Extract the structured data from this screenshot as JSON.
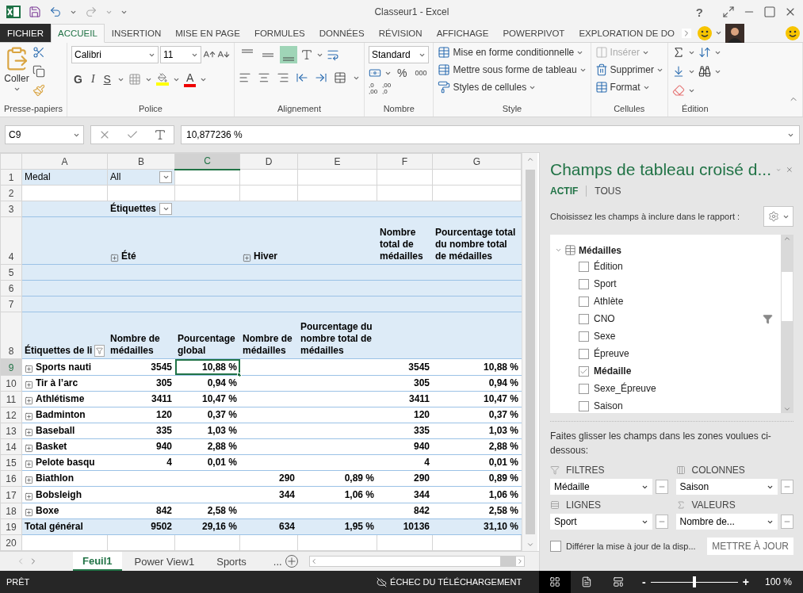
{
  "title_bar": {
    "title": "Classeur1 - Excel",
    "help": "?"
  },
  "ribbon_tabs": [
    {
      "label": "FICHIER",
      "kind": "file",
      "selected": false
    },
    {
      "label": "ACCUEIL",
      "kind": "tab",
      "selected": true
    },
    {
      "label": "INSERTION",
      "kind": "tab",
      "selected": false
    },
    {
      "label": "MISE EN PAGE",
      "kind": "tab",
      "selected": false
    },
    {
      "label": "FORMULES",
      "kind": "tab",
      "selected": false
    },
    {
      "label": "DONNÉES",
      "kind": "tab",
      "selected": false
    },
    {
      "label": "RÉVISION",
      "kind": "tab",
      "selected": false
    },
    {
      "label": "AFFICHAGE",
      "kind": "tab",
      "selected": false
    },
    {
      "label": "POWERPIVOT",
      "kind": "tab",
      "selected": false
    },
    {
      "label": "EXPLORATION DE DO",
      "kind": "tab",
      "selected": false
    }
  ],
  "ribbon": {
    "clipboard": {
      "paste": "Coller",
      "label": "Presse-papiers"
    },
    "font": {
      "name": "Calibri",
      "size": "11",
      "bold": "G",
      "italic": "I",
      "underline": "S",
      "font_color": "A",
      "label": "Police"
    },
    "alignment": {
      "vertical": [
        {
          "selected": false
        },
        {
          "selected": false
        },
        {
          "selected": true
        }
      ],
      "label": "Alignement"
    },
    "number": {
      "format": "Standard",
      "percent": "%",
      "thousands": "000",
      "decimals": [
        [
          ",0",
          ",00"
        ],
        [
          ",00",
          ",0"
        ]
      ],
      "label": "Nombre"
    },
    "styles": {
      "buttons": [
        "Mise en forme conditionnelle",
        "Mettre sous forme de tableau",
        "Styles de cellules"
      ],
      "label": "Style"
    },
    "cells": {
      "buttons": [
        {
          "label": "Insérer",
          "disabled": true
        },
        {
          "label": "Supprimer",
          "disabled": false
        },
        {
          "label": "Format",
          "disabled": false
        }
      ],
      "label": "Cellules"
    },
    "editing": {
      "label": "Édition"
    }
  },
  "formula_bar": {
    "name_box": "C9",
    "formula": "10,877236 %"
  },
  "sheet": {
    "columns": [
      "A",
      "B",
      "C",
      "D",
      "E",
      "F",
      "G"
    ],
    "rows": [
      {
        "num": "1",
        "kind": "page_filter",
        "tall": false,
        "cells": [
          {
            "text": "Medal",
            "selected": false
          },
          {
            "text": "All",
            "dropdown": true,
            "selected": false
          },
          {
            "selected": false
          },
          {
            "selected": false
          },
          {
            "selected": false
          },
          {
            "selected": false
          },
          {
            "selected": false
          }
        ]
      },
      {
        "num": "2",
        "kind": "blank",
        "tall": false,
        "cells": [
          {
            "selected": false
          },
          {
            "selected": false
          },
          {
            "selected": false
          },
          {
            "selected": false
          },
          {
            "selected": false
          },
          {
            "selected": false
          },
          {
            "selected": false
          }
        ]
      },
      {
        "num": "3",
        "kind": "header",
        "tall": false,
        "cells": [
          {
            "selected": false
          },
          {
            "text": "Étiquettes",
            "dropdown": true,
            "selected": false
          },
          {
            "selected": false
          },
          {
            "selected": false
          },
          {
            "selected": false
          },
          {
            "selected": false
          },
          {
            "selected": false
          }
        ]
      },
      {
        "num": "4",
        "kind": "header",
        "tall": true,
        "cells": [
          {
            "selected": false
          },
          {
            "text": "Été",
            "expand": true,
            "selected": false
          },
          {
            "selected": false
          },
          {
            "text": "Hiver",
            "expand": true,
            "selected": false
          },
          {
            "selected": false
          },
          {
            "text": "Nombre total de médailles",
            "selected": false
          },
          {
            "text": "Pourcentage total du nombre total de médailles",
            "selected": false
          }
        ]
      },
      {
        "num": "5",
        "kind": "header",
        "tall": false,
        "cells": [
          {
            "selected": false
          },
          {
            "selected": false
          },
          {
            "selected": false
          },
          {
            "selected": false
          },
          {
            "selected": false
          },
          {
            "selected": false
          },
          {
            "selected": false
          }
        ]
      },
      {
        "num": "6",
        "kind": "header",
        "tall": false,
        "cells": [
          {
            "selected": false
          },
          {
            "selected": false
          },
          {
            "selected": false
          },
          {
            "selected": false
          },
          {
            "selected": false
          },
          {
            "selected": false
          },
          {
            "selected": false
          }
        ]
      },
      {
        "num": "7",
        "kind": "header",
        "tall": false,
        "cells": [
          {
            "selected": false
          },
          {
            "selected": false
          },
          {
            "selected": false
          },
          {
            "selected": false
          },
          {
            "selected": false
          },
          {
            "selected": false
          },
          {
            "selected": false
          }
        ]
      },
      {
        "num": "8",
        "kind": "header",
        "tall": true,
        "cells": [
          {
            "text": "Étiquettes de li",
            "filter": true,
            "selected": false
          },
          {
            "text": "Nombre de médailles",
            "selected": false
          },
          {
            "text": "Pourcentage global",
            "selected": false
          },
          {
            "text": "Nombre de médailles",
            "selected": false
          },
          {
            "text": "Pourcentage du nombre total de médailles",
            "selected": false
          },
          {
            "selected": false
          },
          {
            "selected": false
          }
        ]
      },
      {
        "num": "9",
        "kind": "data",
        "tall": false,
        "cells": [
          {
            "text": "Sports nauti",
            "expand": true,
            "selected": false
          },
          {
            "text": "3545",
            "selected": false
          },
          {
            "text": "10,88 %",
            "selected": true
          },
          {
            "selected": false
          },
          {
            "selected": false
          },
          {
            "text": "3545",
            "selected": false
          },
          {
            "text": "10,88 %",
            "selected": false
          }
        ]
      },
      {
        "num": "10",
        "kind": "data",
        "tall": false,
        "cells": [
          {
            "text": "Tir à l’arc",
            "expand": true,
            "selected": false
          },
          {
            "text": "305",
            "selected": false
          },
          {
            "text": "0,94 %",
            "selected": false
          },
          {
            "selected": false
          },
          {
            "selected": false
          },
          {
            "text": "305",
            "selected": false
          },
          {
            "text": "0,94 %",
            "selected": false
          }
        ]
      },
      {
        "num": "11",
        "kind": "data",
        "tall": false,
        "cells": [
          {
            "text": "Athlétisme",
            "expand": true,
            "selected": false
          },
          {
            "text": "3411",
            "selected": false
          },
          {
            "text": "10,47 %",
            "selected": false
          },
          {
            "selected": false
          },
          {
            "selected": false
          },
          {
            "text": "3411",
            "selected": false
          },
          {
            "text": "10,47 %",
            "selected": false
          }
        ]
      },
      {
        "num": "12",
        "kind": "data",
        "tall": false,
        "cells": [
          {
            "text": "Badminton",
            "expand": true,
            "selected": false
          },
          {
            "text": "120",
            "selected": false
          },
          {
            "text": "0,37 %",
            "selected": false
          },
          {
            "selected": false
          },
          {
            "selected": false
          },
          {
            "text": "120",
            "selected": false
          },
          {
            "text": "0,37 %",
            "selected": false
          }
        ]
      },
      {
        "num": "13",
        "kind": "data",
        "tall": false,
        "cells": [
          {
            "text": "Baseball",
            "expand": true,
            "selected": false
          },
          {
            "text": "335",
            "selected": false
          },
          {
            "text": "1,03 %",
            "selected": false
          },
          {
            "selected": false
          },
          {
            "selected": false
          },
          {
            "text": "335",
            "selected": false
          },
          {
            "text": "1,03 %",
            "selected": false
          }
        ]
      },
      {
        "num": "14",
        "kind": "data",
        "tall": false,
        "cells": [
          {
            "text": "Basket",
            "expand": true,
            "selected": false
          },
          {
            "text": "940",
            "selected": false
          },
          {
            "text": "2,88 %",
            "selected": false
          },
          {
            "selected": false
          },
          {
            "selected": false
          },
          {
            "text": "940",
            "selected": false
          },
          {
            "text": "2,88 %",
            "selected": false
          }
        ]
      },
      {
        "num": "15",
        "kind": "data",
        "tall": false,
        "cells": [
          {
            "text": "Pelote basqu",
            "expand": true,
            "selected": false
          },
          {
            "text": "4",
            "selected": false
          },
          {
            "text": "0,01 %",
            "selected": false
          },
          {
            "selected": false
          },
          {
            "selected": false
          },
          {
            "text": "4",
            "selected": false
          },
          {
            "text": "0,01 %",
            "selected": false
          }
        ]
      },
      {
        "num": "16",
        "kind": "data",
        "tall": false,
        "cells": [
          {
            "text": "Biathlon",
            "expand": true,
            "selected": false
          },
          {
            "selected": false
          },
          {
            "selected": false
          },
          {
            "text": "290",
            "selected": false
          },
          {
            "text": "0,89 %",
            "selected": false
          },
          {
            "text": "290",
            "selected": false
          },
          {
            "text": "0,89 %",
            "selected": false
          }
        ]
      },
      {
        "num": "17",
        "kind": "data",
        "tall": false,
        "cells": [
          {
            "text": "Bobsleigh",
            "expand": true,
            "selected": false
          },
          {
            "selected": false
          },
          {
            "selected": false
          },
          {
            "text": "344",
            "selected": false
          },
          {
            "text": "1,06 %",
            "selected": false
          },
          {
            "text": "344",
            "selected": false
          },
          {
            "text": "1,06 %",
            "selected": false
          }
        ]
      },
      {
        "num": "18",
        "kind": "data",
        "tall": false,
        "cells": [
          {
            "text": "Boxe",
            "expand": true,
            "selected": false
          },
          {
            "text": "842",
            "selected": false
          },
          {
            "text": "2,58 %",
            "selected": false
          },
          {
            "selected": false
          },
          {
            "selected": false
          },
          {
            "text": "842",
            "selected": false
          },
          {
            "text": "2,58 %",
            "selected": false
          }
        ]
      },
      {
        "num": "19",
        "kind": "total",
        "tall": false,
        "cells": [
          {
            "text": "Total général",
            "selected": false
          },
          {
            "text": "9502",
            "selected": false
          },
          {
            "text": "29,16 %",
            "selected": false
          },
          {
            "text": "634",
            "selected": false
          },
          {
            "text": "1,95 %",
            "selected": false
          },
          {
            "text": "10136",
            "selected": false
          },
          {
            "text": "31,10 %",
            "selected": false
          }
        ]
      },
      {
        "num": "20",
        "kind": "blank",
        "tall": false,
        "cells": [
          {
            "selected": false
          },
          {
            "selected": false
          },
          {
            "selected": false
          },
          {
            "selected": false
          },
          {
            "selected": false
          },
          {
            "selected": false
          },
          {
            "selected": false
          }
        ]
      }
    ]
  },
  "sheet_tabs": {
    "tabs": [
      {
        "label": "Feuil1",
        "selected": true
      },
      {
        "label": "Power View1",
        "selected": false
      },
      {
        "label": "Sports",
        "selected": false
      }
    ],
    "more": "..."
  },
  "pivot_pane": {
    "title": "Champs de tableau croisé d...",
    "tabs": [
      {
        "label": "ACTIF",
        "selected": true
      },
      {
        "label": "TOUS",
        "selected": false
      }
    ],
    "prompt": "Choisissez les champs à inclure dans le rapport :",
    "table": {
      "name": "Médailles",
      "expanded": true,
      "fields": [
        {
          "label": "Édition",
          "checked": false,
          "filtered": false
        },
        {
          "label": "Sport",
          "checked": false,
          "filtered": false
        },
        {
          "label": "Athlète",
          "checked": false,
          "filtered": false
        },
        {
          "label": "CNO",
          "checked": false,
          "filtered": true
        },
        {
          "label": "Sexe",
          "checked": false,
          "filtered": false
        },
        {
          "label": "Épreuve",
          "checked": false,
          "filtered": false
        },
        {
          "label": "Médaille",
          "checked": true,
          "filtered": false
        },
        {
          "label": "Sexe_Épreuve",
          "checked": false,
          "filtered": false
        },
        {
          "label": "Saison",
          "checked": false,
          "filtered": false
        }
      ]
    },
    "drag_hint": "Faites glisser les champs dans les zones voulues ci-dessous:",
    "areas": [
      {
        "kind": "filters",
        "label": "FILTRES",
        "field": "Médaille"
      },
      {
        "kind": "columns",
        "label": "COLONNES",
        "field": "Saison"
      },
      {
        "kind": "rows",
        "label": "LIGNES",
        "field": "Sport"
      },
      {
        "kind": "values",
        "label": "VALEURS",
        "field": "Nombre de..."
      }
    ],
    "defer": {
      "label": "Différer la mise à jour de la disp...",
      "checked": false
    },
    "update_button": "METTRE À JOUR"
  },
  "status_bar": {
    "ready": "PRÊT",
    "upload": "ÉCHEC DU TÉLÉCHARGEMENT",
    "views": [
      {
        "kind": "normal",
        "selected": true
      },
      {
        "kind": "layout",
        "selected": false
      },
      {
        "kind": "pagebreak",
        "selected": false
      }
    ],
    "zoom_out": "-",
    "zoom_in": "+",
    "zoom": {
      "level": 0.5
    },
    "zoom_label": "100 %"
  }
}
